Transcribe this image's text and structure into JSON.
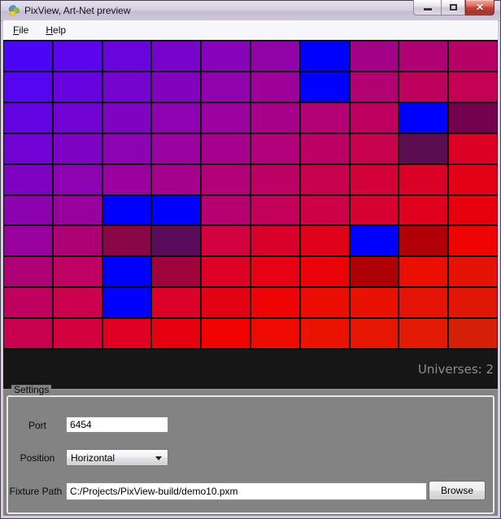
{
  "window": {
    "title": "PixView, Art-Net preview",
    "buttons": [
      {
        "name": "minimize"
      },
      {
        "name": "maximize"
      },
      {
        "name": "close",
        "glyph": "✕"
      }
    ]
  },
  "menu": {
    "items": [
      {
        "label": "File",
        "first": "F",
        "rest": "ile"
      },
      {
        "label": "Help",
        "first": "H",
        "rest": "elp"
      }
    ]
  },
  "grid": {
    "rows": 10,
    "cols": 10,
    "cells": [
      [
        "#4B06F7",
        "#5A05EC",
        "#6904DC",
        "#7804CB",
        "#8603BA",
        "#9102A7",
        "#0000FF",
        "#A40189",
        "#B00174",
        "#B80167"
      ],
      [
        "#5505EF",
        "#6504DF",
        "#7404CE",
        "#8203BD",
        "#9002AB",
        "#9D0199",
        "#0000FF",
        "#B10172",
        "#BD015D",
        "#C40153"
      ],
      [
        "#6304E3",
        "#7204D3",
        "#8003C2",
        "#8E02B1",
        "#9B02A0",
        "#A7018C",
        "#B30176",
        "#BE0160",
        "#0000FF",
        "#740150"
      ],
      [
        "#7103D4",
        "#7F03C4",
        "#8D02B3",
        "#9A02A1",
        "#A6018E",
        "#B2017A",
        "#BD0164",
        "#C7014E",
        "#5C0D52",
        "#DD0026"
      ],
      [
        "#7F02C2",
        "#8D02B1",
        "#9A019F",
        "#A6018D",
        "#B20179",
        "#BD0164",
        "#C8014F",
        "#D20139",
        "#DB0126",
        "#E20116"
      ],
      [
        "#8C02AF",
        "#99019D",
        "#0000FF",
        "#0000FF",
        "#B80171",
        "#C3015B",
        "#CD0146",
        "#D60131",
        "#DF011D",
        "#E7010D"
      ],
      [
        "#99019E",
        "#AE0176",
        "#8A0647",
        "#5A0B59",
        "#D20140",
        "#D9012C",
        "#E0011B",
        "#0000FF",
        "#B10008",
        "#EE0403"
      ],
      [
        "#AE0175",
        "#BE0163",
        "#0000FF",
        "#A0033C",
        "#DD0126",
        "#E60114",
        "#EA0309",
        "#AE0007",
        "#EA0F02",
        "#E51305"
      ],
      [
        "#BE015E",
        "#CB014E",
        "#0000FF",
        "#DC0128",
        "#E30116",
        "#EE0404",
        "#EC0D02",
        "#E81104",
        "#E51406",
        "#E01707"
      ],
      [
        "#C70150",
        "#D3013E",
        "#DE0124",
        "#E60110",
        "#F00300",
        "#EE0A00",
        "#E91301",
        "#E51704",
        "#E21A06",
        "#D42008"
      ]
    ]
  },
  "status_bar": {
    "universes_label": "Universes: 2"
  },
  "settings": {
    "group_title": "Settings",
    "port": {
      "label": "Port",
      "value": "6454"
    },
    "position": {
      "label": "Position",
      "value": "Horizontal"
    },
    "fixture_path": {
      "label": "Fixture Path",
      "value": "C:/Projects/PixView-build/demo10.pxm"
    },
    "browse_label": "Browse"
  },
  "colors": {
    "titlebar": "#D6CFE2",
    "close_button_red": "#C23D33",
    "menu_bg": "#F7F6FB",
    "grid_line": "#0D0D0D",
    "status_bar_bg": "#161616",
    "status_text": "#8E8E8E",
    "panel_bg": "#838383",
    "groupbox_border": "#E8E8E6",
    "pure_blue_cell": "#0000FF"
  }
}
